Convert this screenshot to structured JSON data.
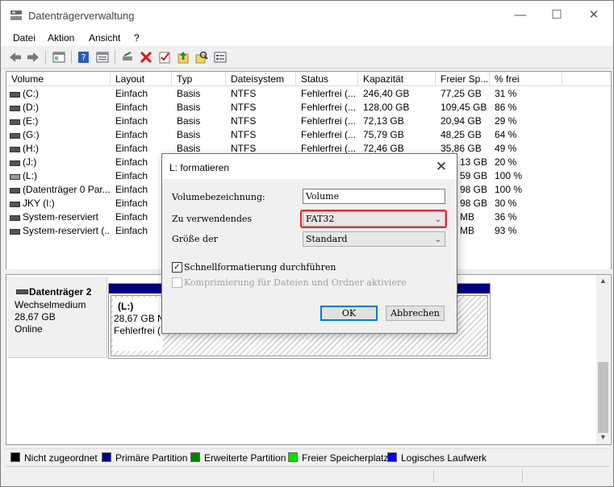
{
  "window": {
    "title": "Datenträgerverwaltung",
    "minimize": "—",
    "maximize": "☐",
    "close": "✕"
  },
  "menu": [
    "Datei",
    "Aktion",
    "Ansicht",
    "?"
  ],
  "columns": [
    "Volume",
    "Layout",
    "Typ",
    "Dateisystem",
    "Status",
    "Kapazität",
    "Freier Sp...",
    "% frei"
  ],
  "volumes": [
    {
      "volume": "(C:)",
      "layout": "Einfach",
      "typ": "Basis",
      "fs": "NTFS",
      "status": "Fehlerfrei (...",
      "cap": "246,40 GB",
      "free": "77,25 GB",
      "pct": "31 %"
    },
    {
      "volume": "(D:)",
      "layout": "Einfach",
      "typ": "Basis",
      "fs": "NTFS",
      "status": "Fehlerfrei (...",
      "cap": "128,00 GB",
      "free": "109,45 GB",
      "pct": "86 %"
    },
    {
      "volume": "(E:)",
      "layout": "Einfach",
      "typ": "Basis",
      "fs": "NTFS",
      "status": "Fehlerfrei (...",
      "cap": "72,13 GB",
      "free": "20,94 GB",
      "pct": "29 %"
    },
    {
      "volume": "(G:)",
      "layout": "Einfach",
      "typ": "Basis",
      "fs": "NTFS",
      "status": "Fehlerfrei (...",
      "cap": "75,79 GB",
      "free": "48,25 GB",
      "pct": "64 %"
    },
    {
      "volume": "(H:)",
      "layout": "Einfach",
      "typ": "Basis",
      "fs": "NTFS",
      "status": "Fehlerfrei (...",
      "cap": "72,46 GB",
      "free": "35,86 GB",
      "pct": "49 %"
    },
    {
      "volume": "(J:)",
      "layout": "Einfach",
      "typ": "",
      "fs": "",
      "status": "",
      "cap": "",
      "free": "13 GB",
      "pct": "20 %"
    },
    {
      "volume": "(L:)",
      "layout": "Einfach",
      "typ": "",
      "fs": "",
      "status": "",
      "cap": "",
      "free": "59 GB",
      "pct": "100 %"
    },
    {
      "volume": "(Datenträger 0 Par...",
      "layout": "Einfach",
      "typ": "",
      "fs": "",
      "status": "",
      "cap": "",
      "free": "98 GB",
      "pct": "100 %"
    },
    {
      "volume": "JKY (I:)",
      "layout": "Einfach",
      "typ": "",
      "fs": "",
      "status": "",
      "cap": "",
      "free": "98 GB",
      "pct": "30 %"
    },
    {
      "volume": "System-reserviert",
      "layout": "Einfach",
      "typ": "",
      "fs": "",
      "status": "",
      "cap": "",
      "free": "MB",
      "pct": "36 %"
    },
    {
      "volume": "System-reserviert (...",
      "layout": "Einfach",
      "typ": "",
      "fs": "",
      "status": "",
      "cap": "",
      "free": "MB",
      "pct": "93 %"
    }
  ],
  "disk": {
    "name": "Datenträger 2",
    "type": "Wechselmedium",
    "size": "28,67 GB",
    "state": "Online",
    "partition": {
      "label": "(L:)",
      "line1": "28,67 GB NT",
      "line2": "Fehlerfrei (P"
    }
  },
  "legend": [
    {
      "label": "Nicht zugeordnet",
      "color": "#000000"
    },
    {
      "label": "Primäre Partition",
      "color": "#000082"
    },
    {
      "label": "Erweiterte Partition",
      "color": "#008000"
    },
    {
      "label": "Freier Speicherplatz",
      "color": "#00e000"
    },
    {
      "label": "Logisches Laufwerk",
      "color": "#0000ff"
    }
  ],
  "dialog": {
    "title": "L: formatieren",
    "close": "✕",
    "label_volume": "Volumebezeichnung:",
    "value_volume": "Volume",
    "label_fs": "Zu verwendendes",
    "value_fs": "FAT32",
    "label_size": "Größe der",
    "value_size": "Standard",
    "quick_format": "Schnellformatierung durchführen",
    "compress": "Komprimierung für Dateien und Ordner aktiviere",
    "ok": "OK",
    "cancel": "Abbrechen"
  }
}
